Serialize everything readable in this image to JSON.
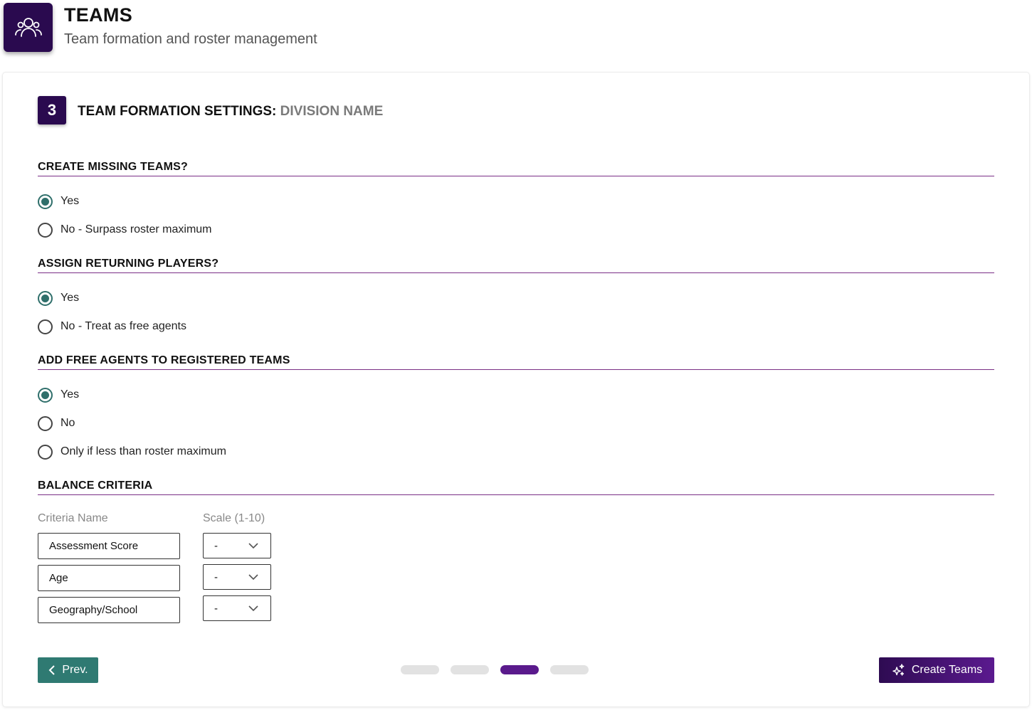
{
  "header": {
    "title": "TEAMS",
    "subtitle": "Team formation and roster management",
    "logo_icon": "people-group-icon"
  },
  "step": {
    "number": "3",
    "title": "TEAM FORMATION SETTINGS:",
    "title_suffix": "DIVISION NAME"
  },
  "sections": {
    "create_missing": {
      "heading": "CREATE MISSING TEAMS?",
      "options": [
        {
          "label": "Yes",
          "checked": true
        },
        {
          "label": "No - Surpass roster maximum",
          "checked": false
        }
      ]
    },
    "assign_returning": {
      "heading": "ASSIGN RETURNING PLAYERS?",
      "options": [
        {
          "label": "Yes",
          "checked": true
        },
        {
          "label": "No - Treat as free agents",
          "checked": false
        }
      ]
    },
    "free_agents": {
      "heading": "ADD FREE AGENTS TO REGISTERED TEAMS",
      "options": [
        {
          "label": "Yes",
          "checked": true
        },
        {
          "label": "No",
          "checked": false
        },
        {
          "label": "Only if less than roster maximum",
          "checked": false
        }
      ]
    },
    "balance": {
      "heading": "BALANCE CRITERIA",
      "col_name": "Criteria Name",
      "col_scale": "Scale (1-10)",
      "rows": [
        {
          "name": "Assessment Score",
          "scale": "-"
        },
        {
          "name": "Age",
          "scale": "-"
        },
        {
          "name": "Geography/School",
          "scale": "-"
        }
      ]
    }
  },
  "footer": {
    "prev_label": "Prev.",
    "create_label": "Create Teams",
    "steps_total": 4,
    "active_step": 3
  },
  "colors": {
    "brand": "#2a0a4f",
    "accent_purple": "#5b1a8f",
    "teal": "#2f7a72",
    "divider": "#7a2f86"
  }
}
